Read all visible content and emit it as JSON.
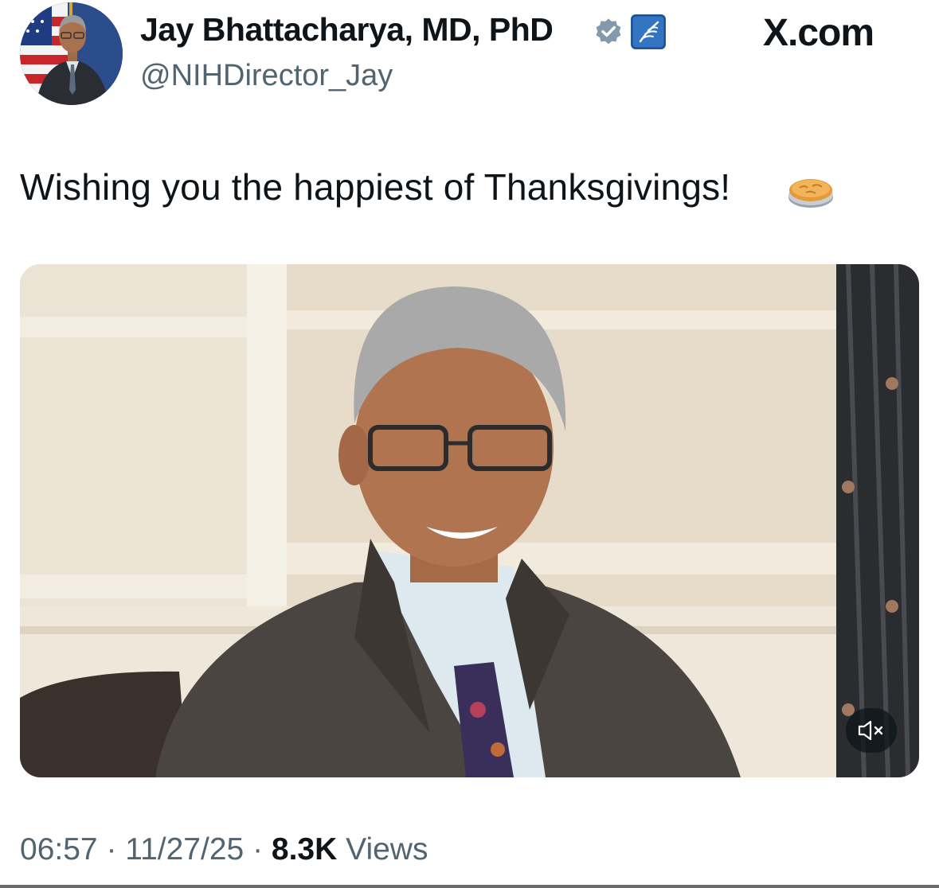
{
  "tweet": {
    "display_name": "Jay Bhattacharya, MD, PhD",
    "handle": "@NIHDirector_Jay",
    "text": "Wishing you the happiest of Thanksgivings!",
    "emoji_icon": "pie-icon",
    "badges": [
      "verified-badge-icon",
      "hhs-affiliation-icon"
    ],
    "time": "06:57",
    "date": "11/27/25",
    "views_count": "8.3K",
    "views_label": "Views",
    "separator": "·"
  },
  "brand": {
    "label": "X.com"
  },
  "video": {
    "muted": true,
    "mute_icon": "speaker-muted-icon"
  },
  "colors": {
    "text": "#0f1419",
    "secondary": "#536471",
    "verified": "#829aab",
    "affiliation": "#2f6fb7"
  }
}
